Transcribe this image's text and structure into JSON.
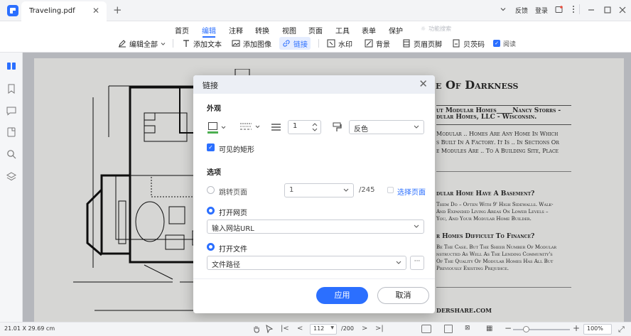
{
  "titlebar": {
    "tab_name": "Traveling.pdf",
    "tab_close": "✕",
    "tab_add": "+",
    "feedback": "反馈",
    "login": "登录"
  },
  "menu": {
    "items": [
      "首页",
      "编辑",
      "注释",
      "转换",
      "视图",
      "页面",
      "工具",
      "表单",
      "保护"
    ],
    "active": "编辑",
    "search_label": "功能搜索"
  },
  "toolbar": {
    "edit_all": "编辑全部",
    "add_text": "添加文本",
    "add_image": "添加图像",
    "link": "链接",
    "watermark": "水印",
    "background": "背景",
    "header_footer": "页眉页脚",
    "bates": "贝茨码",
    "read": "阅读"
  },
  "page": {
    "title": "e Of Darkness",
    "byline1": "ut Modular Homes_____Nancy Storrs -",
    "byline2": "dular Homes, LLC - Wisconsin.",
    "para1a": "Modular .. Homes Are Any Home In Which",
    "para1b": "s Built In A Factory. It Is .. In Sections Or",
    "para1c": "e Modules Are .. To A Building Site, Place",
    "h2": "dular Home Have A Basement?",
    "para2a": "Them Do – Often With 9' High Sidewalls. Walk-",
    "para2b": "And Expanded Living Areas On Lower Levels –",
    "para2c": "You, And Your Modular Home Builder.",
    "h3": "r Homes Difficult To Finance?",
    "para3a": "Be The Case. But The Sheer Number Of Modular",
    "para3b": "nstructed As Well As The Lending Community's",
    "para3c": "Of The Quality Of Modular Homes Has All But",
    "para3d": "Previously Existing Prejudice.",
    "footer": "dershare.com"
  },
  "dialog": {
    "title": "链接",
    "close": "✕",
    "appearance_label": "外观",
    "line_width": "1",
    "highlight": "反色",
    "visible_rect": "可见的矩形",
    "options_label": "选项",
    "goto_page": "跳转页面",
    "page_value": "1",
    "page_total": "/245",
    "select_page": "选择页面",
    "open_web": "打开网页",
    "url_placeholder": "输入网站URL",
    "open_file": "打开文件",
    "file_placeholder": "文件路径",
    "browse": "···",
    "apply": "应用",
    "cancel": "取消"
  },
  "status": {
    "dims": "21.01 X 29.69 cm",
    "page_current": "112",
    "page_total": "/200",
    "zoom": "100%"
  },
  "colors": {
    "accent": "#2b6fff",
    "border_color": "#4caf50"
  }
}
